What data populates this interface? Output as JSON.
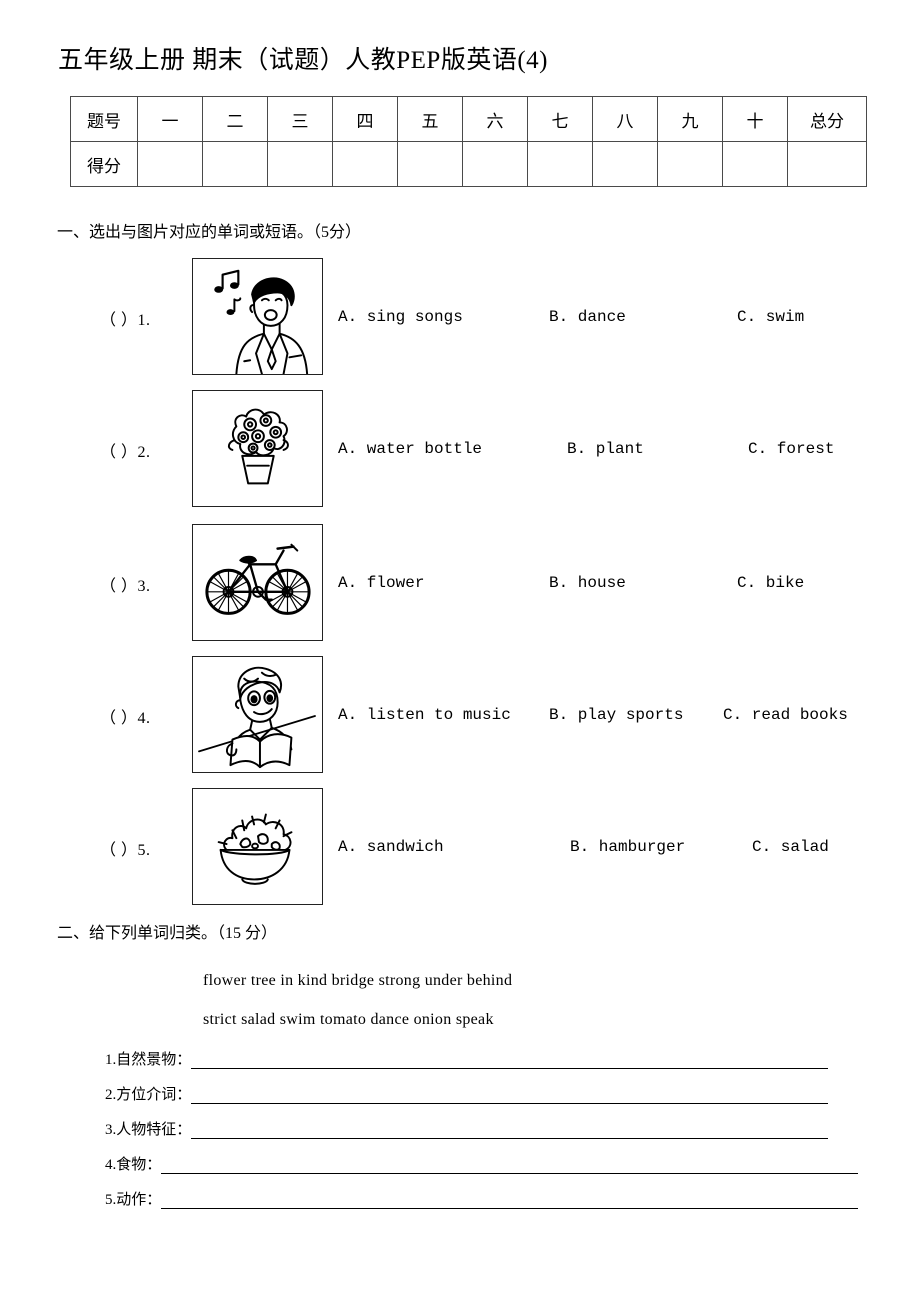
{
  "document": {
    "title": "五年级上册 期末（试题）人教PEP版英语(4)"
  },
  "score_table": {
    "row_header_label": "题号",
    "row_score_label": "得分",
    "columns": [
      "一",
      "二",
      "三",
      "四",
      "五",
      "六",
      "七",
      "八",
      "九",
      "十"
    ],
    "total_label": "总分"
  },
  "section1": {
    "heading": "一、选出与图片对应的单词或短语。（5分）",
    "questions": [
      {
        "marker": "（   ）1.",
        "image": "man-singing-with-music-notes-icon",
        "options": [
          "A. sing songs",
          "B. dance",
          "C. swim"
        ]
      },
      {
        "marker": "（   ）2.",
        "image": "potted-flowers-icon",
        "options": [
          "A. water bottle",
          "B. plant",
          "C. forest"
        ]
      },
      {
        "marker": "（   ）3.",
        "image": "bicycle-icon",
        "options": [
          "A. flower",
          "B. house",
          "C. bike"
        ]
      },
      {
        "marker": "（   ）4.",
        "image": "boy-reading-book-icon",
        "options": [
          "A. listen to music",
          "B. play sports",
          "C. read books"
        ]
      },
      {
        "marker": "（   ）5.",
        "image": "salad-bowl-icon",
        "options": [
          "A. sandwich",
          "B. hamburger",
          "C. salad"
        ]
      }
    ]
  },
  "section2": {
    "heading": "二、给下列单词归类。（15 分）",
    "word_bank_lines": [
      "flower tree  in kind bridge strong  under  behind",
      "strict salad  swim  tomato dance onion speak"
    ],
    "categories": [
      "1.自然景物：",
      "2.方位介词：",
      "3.人物特征：",
      "4.食物：",
      "5.动作："
    ]
  },
  "colors": {
    "ink": "#000000",
    "table_border": "#4a4a4a",
    "page_background": "#ffffff"
  }
}
